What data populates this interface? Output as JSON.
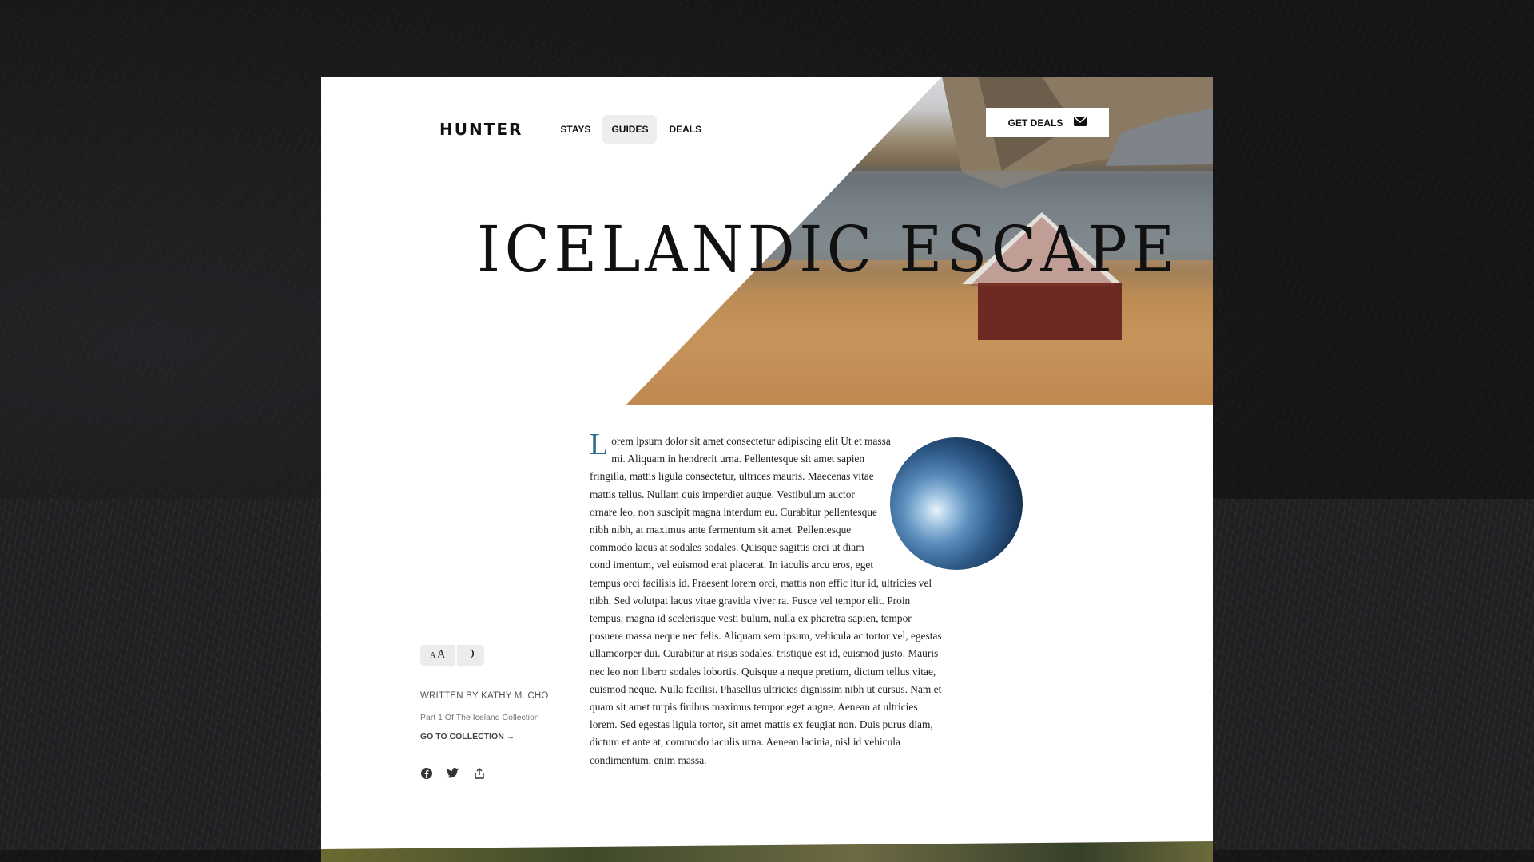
{
  "brand": {
    "logo": "HUNTER"
  },
  "nav": {
    "items": [
      {
        "label": "STAYS",
        "active": false
      },
      {
        "label": "GUIDES",
        "active": true
      },
      {
        "label": "DEALS",
        "active": false
      }
    ],
    "cta_label": "GET DEALS",
    "cta_icon": "mail-icon"
  },
  "hero": {
    "title": "ICELANDIC ESCAPE"
  },
  "article": {
    "drop_cap": "L",
    "lead": "orem ipsum dolor sit amet consectetur adipiscing elit Ut et massa mi. Aliquam in hendrerit urna. Pellentesque sit amet sapien fringilla, mattis ligula consectetur, ultrices mauris. Maecenas vitae mattis tellus. Nullam quis imperdiet augue. Vestibulum auctor ornare leo, non suscipit magna interdum eu. Curabitur pellentesque nibh nibh, at maximus ante fermentum sit amet. Pellentesque commodo lacus at sodales sodales. ",
    "link": "Quisque sagittis orci ",
    "rest": "ut diam cond imentum, vel euismod erat placerat. In iaculis arcu eros, eget tempus orci facilisis id. Praesent lorem orci, mattis non effic itur id, ultricies vel nibh. Sed volutpat lacus vitae gravida viver ra. Fusce vel tempor elit. Proin tempus, magna id scelerisque vesti bulum, nulla ex pharetra sapien, tempor posuere massa neque nec felis. Aliquam sem ipsum, vehicula ac tortor vel, egestas ullamcorper dui. Curabitur at risus sodales, tristique est id, euismod justo. Mauris nec leo non libero sodales lobortis. Quisque a neque pretium, dictum tellus vitae, euismod neque. Nulla facilisi. Phasellus ultricies dignissim nibh ut cursus. Nam et quam sit amet turpis finibus maximus tempor eget augue. Aenean at ultricies lorem. Sed egestas ligula tortor, sit amet mattis ex feugiat non. Duis purus diam, dictum et ante at, commodo iaculis urna. Aenean lacinia, nisl id vehicula condimentum, enim massa."
  },
  "sidebar": {
    "font_toggle_small": "A",
    "font_toggle_large": "A",
    "dark_mode_icon": "moon-icon",
    "byline": "WRITTEN BY KATHY M. CHO",
    "series": "Part 1 Of The Iceland Collection",
    "collection_link": "GO TO COLLECTION",
    "collection_arrow": "→",
    "social": [
      "facebook-icon",
      "twitter-icon",
      "share-icon"
    ]
  },
  "colors": {
    "accent": "#2e6b86",
    "background": "#141416",
    "page": "#ffffff"
  }
}
